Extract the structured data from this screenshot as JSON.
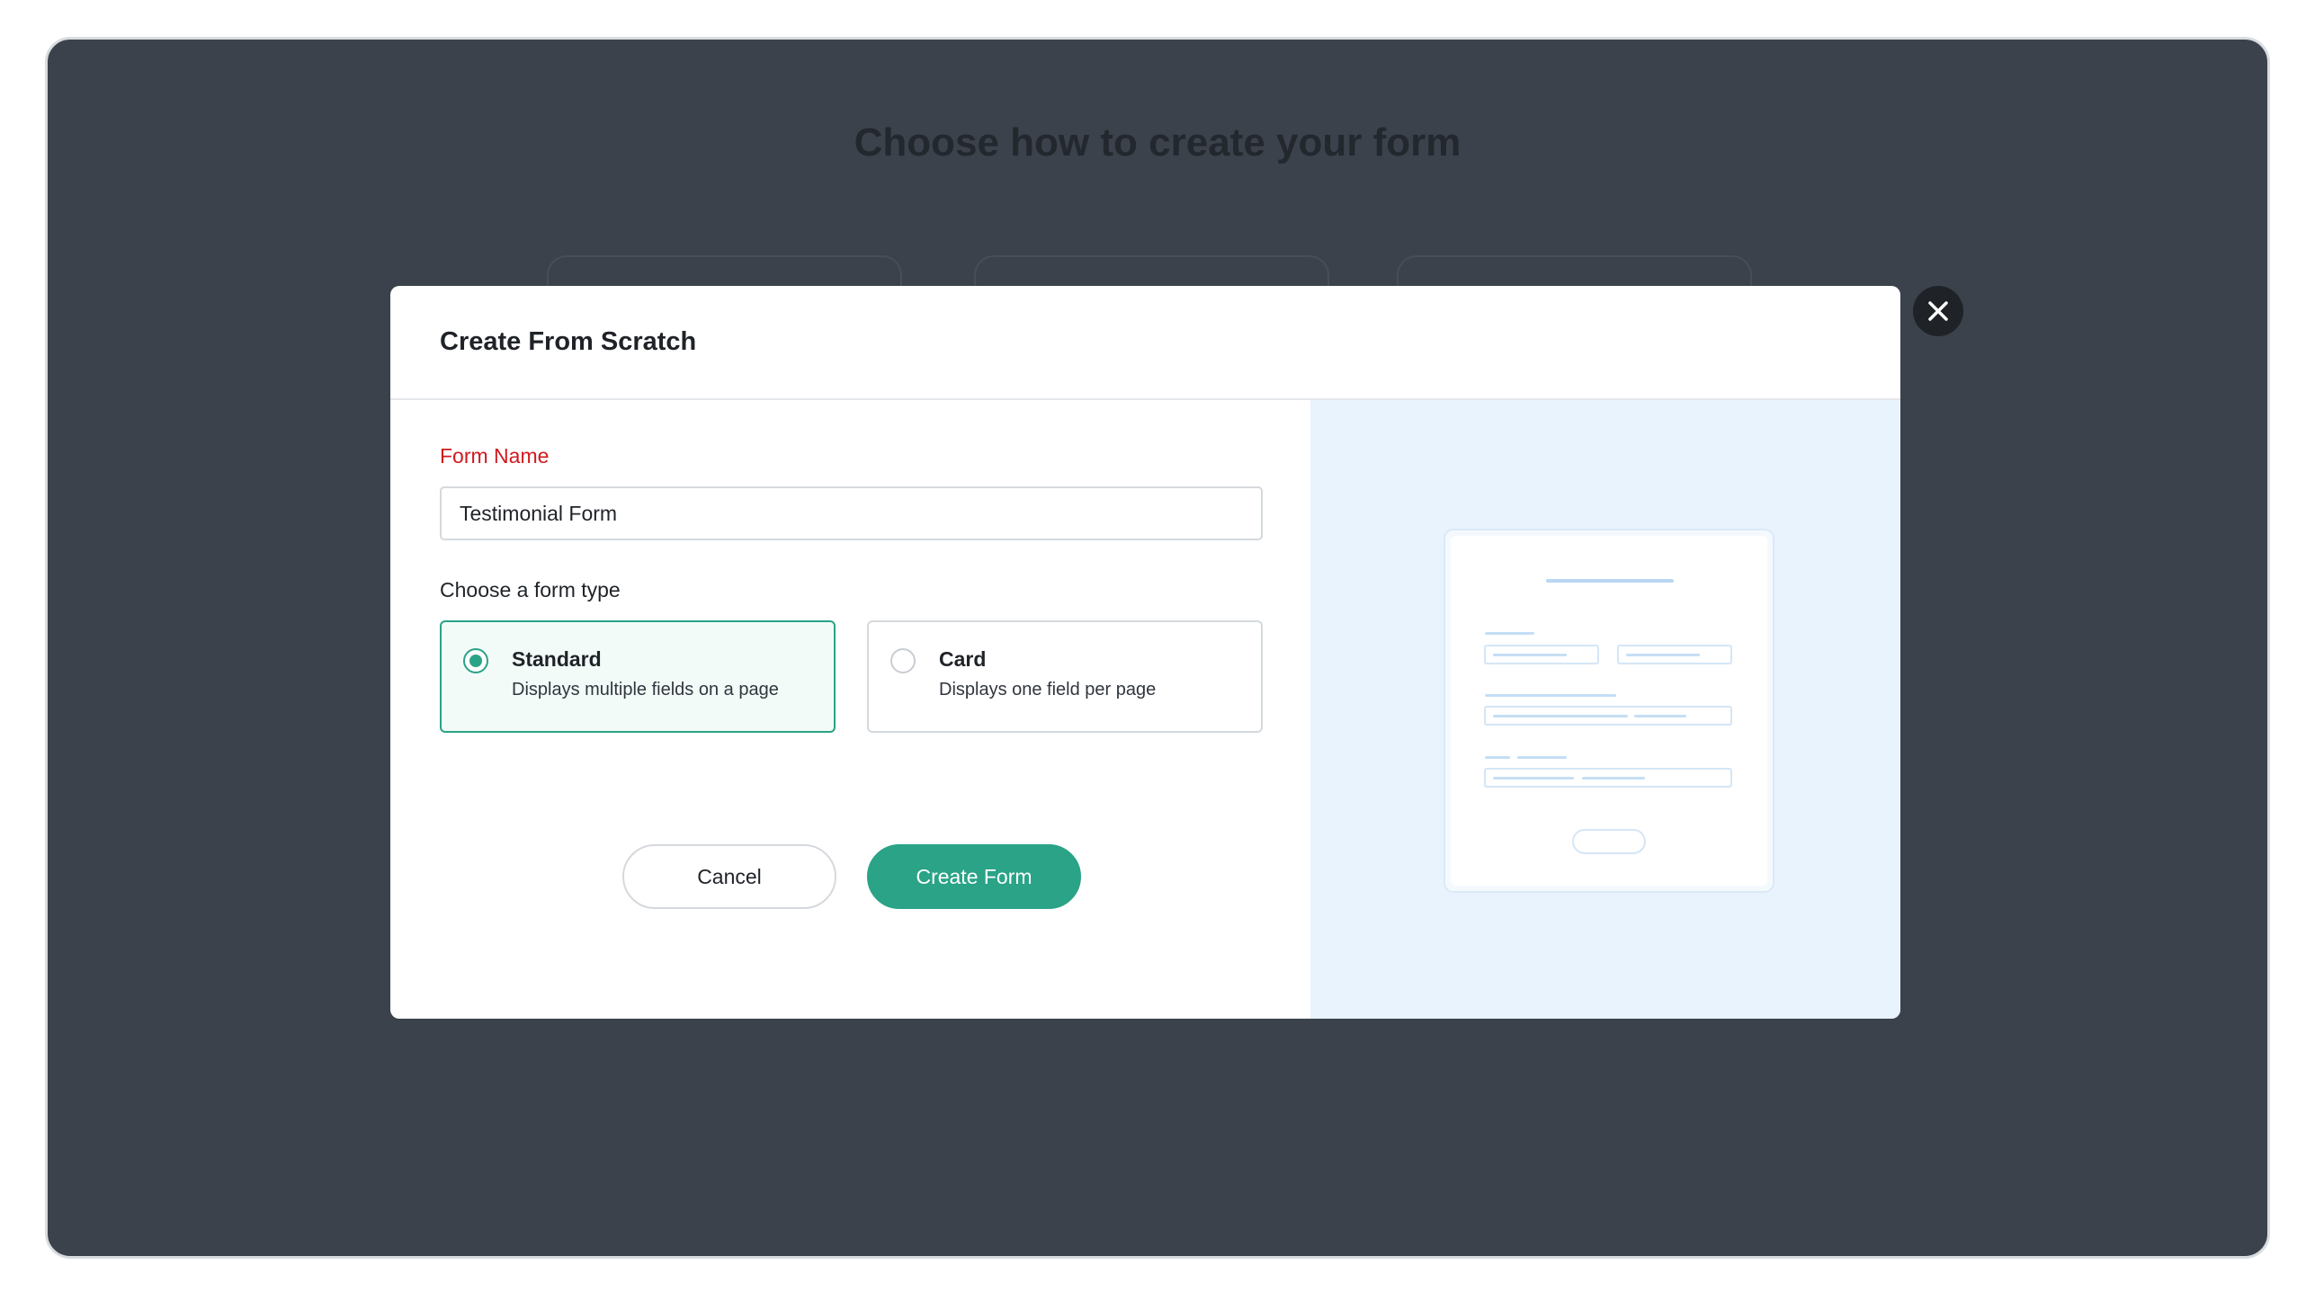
{
  "background": {
    "title": "Choose how to create your form"
  },
  "modal": {
    "title": "Create From Scratch",
    "form_name_label": "Form Name",
    "form_name_value": "Testimonial Form",
    "form_type_label": "Choose a form type",
    "options": [
      {
        "title": "Standard",
        "description": "Displays multiple fields on a page",
        "selected": true
      },
      {
        "title": "Card",
        "description": "Displays one field per page",
        "selected": false
      }
    ],
    "cancel_label": "Cancel",
    "create_label": "Create Form"
  },
  "icons": {
    "close": "close-icon",
    "preview": "form-preview-illustration"
  },
  "colors": {
    "accent": "#2aa387",
    "required_label": "#d0191e",
    "overlay": "#3b424b",
    "preview_bg": "#e8f3fe"
  }
}
